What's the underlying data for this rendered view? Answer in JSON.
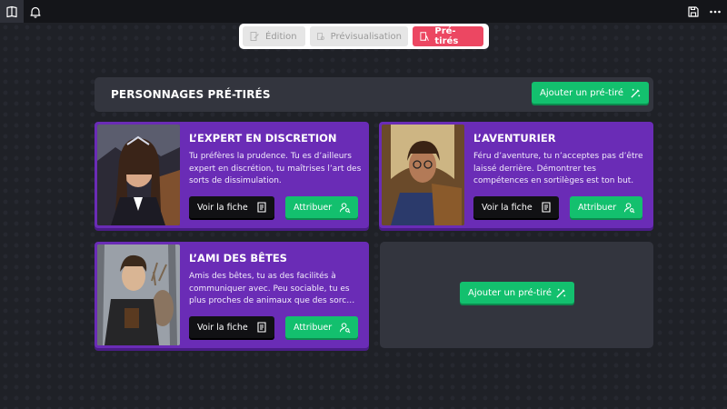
{
  "topbar": {
    "left_icons": [
      "book-icon",
      "bell-icon"
    ],
    "right_icons": [
      "save-icon",
      "more-icon"
    ]
  },
  "modes": [
    {
      "label": "Édition",
      "icon": "edit-doc-icon",
      "active": false
    },
    {
      "label": "Prévisualisation",
      "icon": "preview-doc-icon",
      "active": true
    },
    {
      "label": "Pré-tirés",
      "icon": "pretires-doc-icon",
      "active": true
    }
  ],
  "header": {
    "title": "PERSONNAGES PRÉ-TIRÉS",
    "add_label": "Ajouter un pré-tiré"
  },
  "cards": [
    {
      "title": "L’EXPERT EN DISCRETION",
      "description": "Tu préfères la prudence. Tu es d’ailleurs expert en discrétion, tu maîtrises l’art des sorts de dissimulation.",
      "view_label": "Voir la fiche",
      "assign_label": "Attribuer"
    },
    {
      "title": "L’AVENTURIER",
      "description": "Féru d’aventure, tu n’acceptes pas d’être laissé derrière. Démontrer tes compétences en sortilèges est ton but.",
      "view_label": "Voir la fiche",
      "assign_label": "Attribuer"
    },
    {
      "title": "L’AMI DES BÊTES",
      "description": "Amis des bêtes, tu as des facilités à communiquer avec. Peu sociable, tu es plus proches de animaux que des sorc…",
      "view_label": "Voir la fiche",
      "assign_label": "Attribuer"
    }
  ],
  "empty_slot": {
    "add_label": "Ajouter un pré-tiré"
  },
  "colors": {
    "accent_pink": "#ec4762",
    "accent_green": "#13c06e",
    "card_purple": "#6a2cb6",
    "panel": "#33353e"
  }
}
